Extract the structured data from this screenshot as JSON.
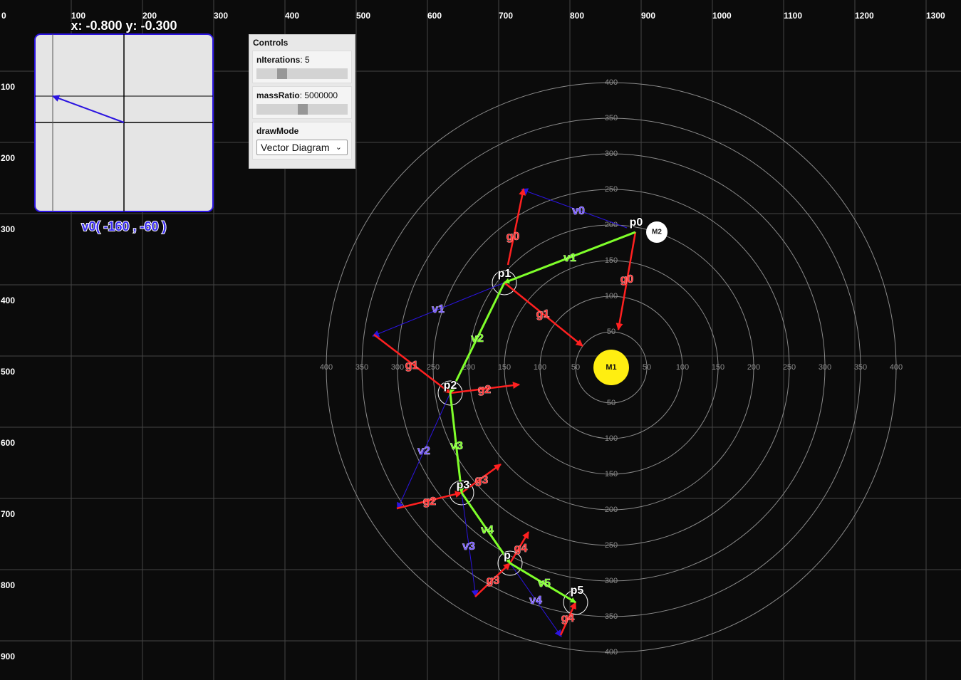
{
  "grid": {
    "x_ticks": [
      "0",
      "100",
      "200",
      "300",
      "400",
      "500",
      "600",
      "700",
      "800",
      "900",
      "1000",
      "1100",
      "1200",
      "1300"
    ],
    "y_ticks": [
      "100",
      "200",
      "300",
      "400",
      "500",
      "600",
      "700",
      "800",
      "900"
    ]
  },
  "polar": {
    "left_labels": [
      "400",
      "350",
      "300",
      "250",
      "200",
      "150",
      "100",
      "50"
    ],
    "right_labels": [
      "50",
      "100",
      "150",
      "200",
      "250",
      "300",
      "350",
      "400"
    ],
    "up_labels": [
      "50",
      "100",
      "150",
      "200",
      "250",
      "300",
      "350",
      "400"
    ],
    "down_labels": [
      "50",
      "100",
      "150",
      "200",
      "250",
      "300",
      "350",
      "400"
    ]
  },
  "bodies": {
    "m1_label": "M1",
    "m2_label": "M2"
  },
  "colors": {
    "velocity": "#7fff2a",
    "gravity": "#ff2020",
    "initial": "#2b14e0",
    "body": "#ffee11",
    "grid": "#8a8a8a"
  },
  "pad": {
    "readout": "x: -0.800 y: -0.300",
    "caption": "v0( -160 , -60 )"
  },
  "controls": {
    "title": "Controls",
    "iterations_label": "nIterations",
    "iterations_value": "5",
    "iterations_fraction": 0.25,
    "mass_label": "massRatio",
    "mass_value": "5000000",
    "mass_fraction": 0.5,
    "draw_label": "drawMode",
    "draw_value": "Vector Diagram"
  },
  "diagram_labels": [
    "p0",
    "p1",
    "p2",
    "p3",
    "p",
    "p5",
    "v0",
    "v1",
    "v1",
    "v2",
    "v2",
    "v3",
    "v3",
    "v4",
    "v4",
    "v5",
    "g0",
    "g0",
    "g1",
    "g1",
    "g2",
    "g2",
    "g3",
    "g3",
    "g4",
    "g4"
  ]
}
